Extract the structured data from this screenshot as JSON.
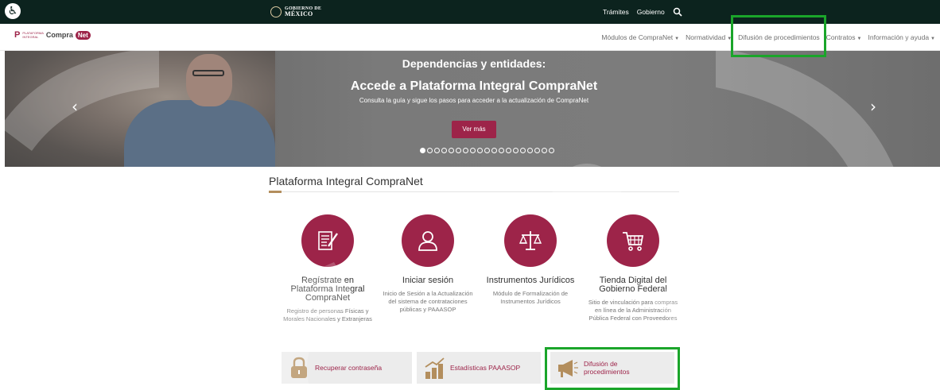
{
  "govbar": {
    "access_icon": "accessibility-icon",
    "gov_logo_line1": "GOBIERNO DE",
    "gov_logo_line2": "MÉXICO",
    "links": [
      "Trámites",
      "Gobierno"
    ],
    "search_icon": "search-icon"
  },
  "brand": {
    "p": "P",
    "small_top": "PLATAFORMA",
    "small_bottom": "INTEGRAL",
    "compra": "Compra",
    "net": "Net"
  },
  "nav": {
    "items": [
      {
        "label": "Módulos de CompraNet",
        "caret": "▼"
      },
      {
        "label": "Normatividad",
        "caret": "▼"
      },
      {
        "label": "Difusión de procedimientos",
        "caret": ""
      },
      {
        "label": "Contratos",
        "caret": "▼"
      },
      {
        "label": "Información y ayuda",
        "caret": "▼"
      }
    ]
  },
  "hero": {
    "eyebrow": "Dependencias y entidades:",
    "headline": "Accede a Plataforma Integral CompraNet",
    "subline": "Consulta la guía y sigue los pasos para acceder a la actualización de CompraNet",
    "cta": "Ver más",
    "prev": "‹",
    "next": "›",
    "slide_count": 19,
    "active_slide": 1
  },
  "section": {
    "title": "Plataforma Integral CompraNet"
  },
  "cards": [
    {
      "title": "Regístrate en Plataforma Integral CompraNet",
      "desc": "Registro de personas Físicas y Morales Nacionales y Extranjeras",
      "icon": "form-edit-icon"
    },
    {
      "title": "Iniciar sesión",
      "desc": "Inicio de Sesión a la Actualización del sistema de contrataciones públicas y PAAASOP",
      "icon": "user-icon"
    },
    {
      "title": "Instrumentos Jurídicos",
      "desc": "Módulo de Formalización de Instrumentos Jurídicos",
      "icon": "scales-icon"
    },
    {
      "title": "Tienda Digital del Gobierno Federal",
      "desc": "Sitio de vinculación para compras en línea de la Administración Pública Federal con Proveedores",
      "icon": "shopping-cart-icon"
    }
  ],
  "quick_links": [
    {
      "label": "Recuperar contraseña",
      "icon": "padlock-icon"
    },
    {
      "label": "Estadísticas PAAASOP",
      "icon": "bar-chart-icon"
    },
    {
      "label": "Difusión de procedimientos",
      "icon": "megaphone-icon"
    }
  ],
  "colors": {
    "gov_dark": "#0c231e",
    "brand": "#9d2449",
    "gold": "#b38e5d",
    "highlight": "#1aa52a"
  }
}
